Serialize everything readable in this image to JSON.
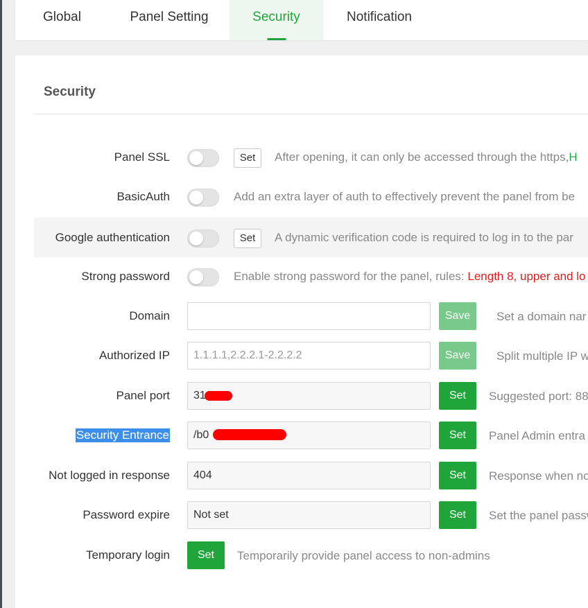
{
  "tabs": [
    {
      "label": "Global"
    },
    {
      "label": "Panel Setting"
    },
    {
      "label": "Security"
    },
    {
      "label": "Notification"
    }
  ],
  "active_tab": "Security",
  "section_title": "Security",
  "settings": {
    "panel_ssl": {
      "label": "Panel SSL",
      "button": "Set",
      "desc": "After opening, it can only be accessed through the https,",
      "desc_tail": "H"
    },
    "basic_auth": {
      "label": "BasicAuth",
      "desc": "Add an extra layer of auth to effectively prevent the panel from be"
    },
    "google_auth": {
      "label": "Google authentication",
      "button": "Set",
      "desc": "A dynamic verification code is required to log in to the par"
    },
    "strong_password": {
      "label": "Strong password",
      "desc": "Enable strong password for the panel, rules: ",
      "desc_rules": "Length 8, upper and lo"
    },
    "domain": {
      "label": "Domain",
      "value": "",
      "button": "Save",
      "desc": "Set a domain nar"
    },
    "authorized_ip": {
      "label": "Authorized IP",
      "placeholder": "1.1.1.1,2.2.2.1-2.2.2.2",
      "button": "Save",
      "desc": "Split multiple IP w"
    },
    "panel_port": {
      "label": "Panel port",
      "value": "31",
      "button": "Set",
      "desc": "Suggested port: 88"
    },
    "security_entrance": {
      "label": "Security Entrance",
      "value": "/b0",
      "button": "Set",
      "desc": "Panel Admin entra"
    },
    "not_logged_response": {
      "label": "Not logged in response",
      "value": "404",
      "button": "Set",
      "desc": "Response when no"
    },
    "password_expire": {
      "label": "Password expire",
      "value": "Not set",
      "button": "Set",
      "desc": "Set the panel passw"
    },
    "temporary_login": {
      "label": "Temporary login",
      "button": "Set",
      "desc": "Temporarily provide panel access to non-admins"
    }
  },
  "colors": {
    "accent": "#20a53a",
    "accent_disabled": "#79c98a",
    "highlight": "#3b8fea",
    "warning_text": "#e01e1e"
  }
}
